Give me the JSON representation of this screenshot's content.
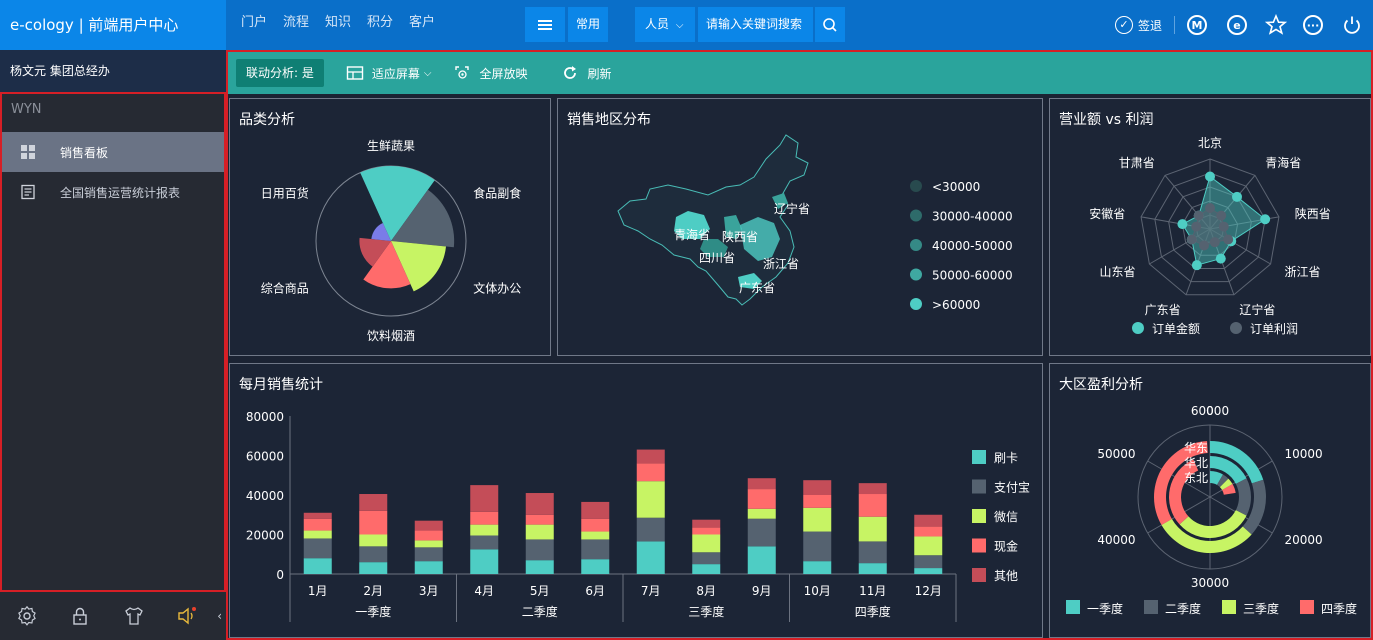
{
  "topbar": {
    "brand": "e-cology | 前端用户中心",
    "nav": [
      "门户",
      "流程",
      "知识",
      "积分",
      "客户"
    ],
    "common_label": "常用",
    "search_type": "人员",
    "search_placeholder": "请输入关键词搜索",
    "signin_label": "签退"
  },
  "sidebar": {
    "user": "杨文元  集团总经办",
    "group_title": "WYN",
    "items": [
      {
        "label": "销售看板",
        "active": true
      },
      {
        "label": "全国销售运营统计报表",
        "active": false
      }
    ]
  },
  "toolbar": {
    "linked": "联动分析: 是",
    "fit": "适应屏幕",
    "fullscreen": "全屏放映",
    "refresh": "刷新"
  },
  "colors": {
    "teal": "#4ecdc4",
    "slate": "#556270",
    "lime": "#c7f464",
    "coral": "#ff6b6b",
    "red": "#c44d58",
    "purple": "#7a7ce8"
  },
  "panels": {
    "category": "品类分析",
    "region": "销售地区分布",
    "radar": "营业额 vs 利润",
    "monthly": "每月销售统计",
    "profit": "大区盈利分析"
  },
  "chart_data": [
    {
      "type": "pie",
      "subtype": "rose",
      "categories": [
        "生鲜蔬果",
        "食品副食",
        "文体办公",
        "饮料烟酒",
        "综合商品",
        "日用百货"
      ],
      "values": [
        95,
        80,
        70,
        60,
        40,
        25
      ],
      "colors": [
        "#4ecdc4",
        "#556270",
        "#c7f464",
        "#ff6b6b",
        "#c44d58",
        "#7a7ce8"
      ]
    },
    {
      "type": "map",
      "region_labels": [
        "辽宁省",
        "青海省",
        "陕西省",
        "四川省",
        "浙江省",
        "广东省"
      ],
      "legend": [
        "<30000",
        "30000-40000",
        "40000-50000",
        "50000-60000",
        ">60000"
      ]
    },
    {
      "type": "radar",
      "axes": [
        "北京",
        "青海省",
        "陕西省",
        "浙江省",
        "辽宁省",
        "广东省",
        "山东省",
        "安徽省",
        "甘肃省"
      ],
      "series": [
        {
          "name": "订单金额",
          "values": [
            0.75,
            0.6,
            0.8,
            0.35,
            0.45,
            0.55,
            0.3,
            0.4,
            0.25
          ]
        },
        {
          "name": "订单利润",
          "values": [
            0.3,
            0.25,
            0.2,
            0.3,
            0.2,
            0.25,
            0.3,
            0.2,
            0.25
          ]
        }
      ]
    },
    {
      "type": "bar",
      "stacked": true,
      "categories": [
        "1月",
        "2月",
        "3月",
        "4月",
        "5月",
        "6月",
        "7月",
        "8月",
        "9月",
        "10月",
        "11月",
        "12月"
      ],
      "groups": [
        "一季度",
        "二季度",
        "三季度",
        "四季度"
      ],
      "ylim": [
        0,
        80000
      ],
      "yticks": [
        0,
        20000,
        40000,
        60000,
        80000
      ],
      "series": [
        {
          "name": "刷卡",
          "values": [
            8000,
            6000,
            6500,
            12500,
            7000,
            7500,
            16500,
            5000,
            14000,
            6500,
            5500,
            3000
          ]
        },
        {
          "name": "支付宝",
          "values": [
            10000,
            8000,
            7000,
            7000,
            10500,
            10000,
            12000,
            6000,
            14000,
            15000,
            11000,
            6500
          ]
        },
        {
          "name": "微信",
          "values": [
            4000,
            6000,
            3500,
            5500,
            7500,
            4000,
            18500,
            9000,
            5000,
            12000,
            12500,
            9500
          ]
        },
        {
          "name": "现金",
          "values": [
            6000,
            12000,
            5000,
            6500,
            5000,
            6500,
            9000,
            3500,
            10000,
            6500,
            11500,
            5000
          ]
        },
        {
          "name": "其他",
          "values": [
            3000,
            8500,
            5000,
            13500,
            11000,
            8500,
            7000,
            4000,
            5500,
            7500,
            5500,
            6000
          ]
        }
      ]
    },
    {
      "type": "bar",
      "subtype": "polar-stacked",
      "categories": [
        "华东",
        "华北",
        "东北"
      ],
      "angle_ticks": [
        0,
        10000,
        20000,
        30000,
        40000,
        50000,
        60000
      ],
      "amax": 60000,
      "series": [
        {
          "name": "一季度",
          "values": [
            12000,
            10500,
            5000
          ]
        },
        {
          "name": "二季度",
          "values": [
            10000,
            9000,
            2500
          ]
        },
        {
          "name": "三季度",
          "values": [
            18000,
            18500,
            2500
          ]
        },
        {
          "name": "四季度",
          "values": [
            19500,
            18000,
            3500
          ]
        }
      ]
    }
  ]
}
